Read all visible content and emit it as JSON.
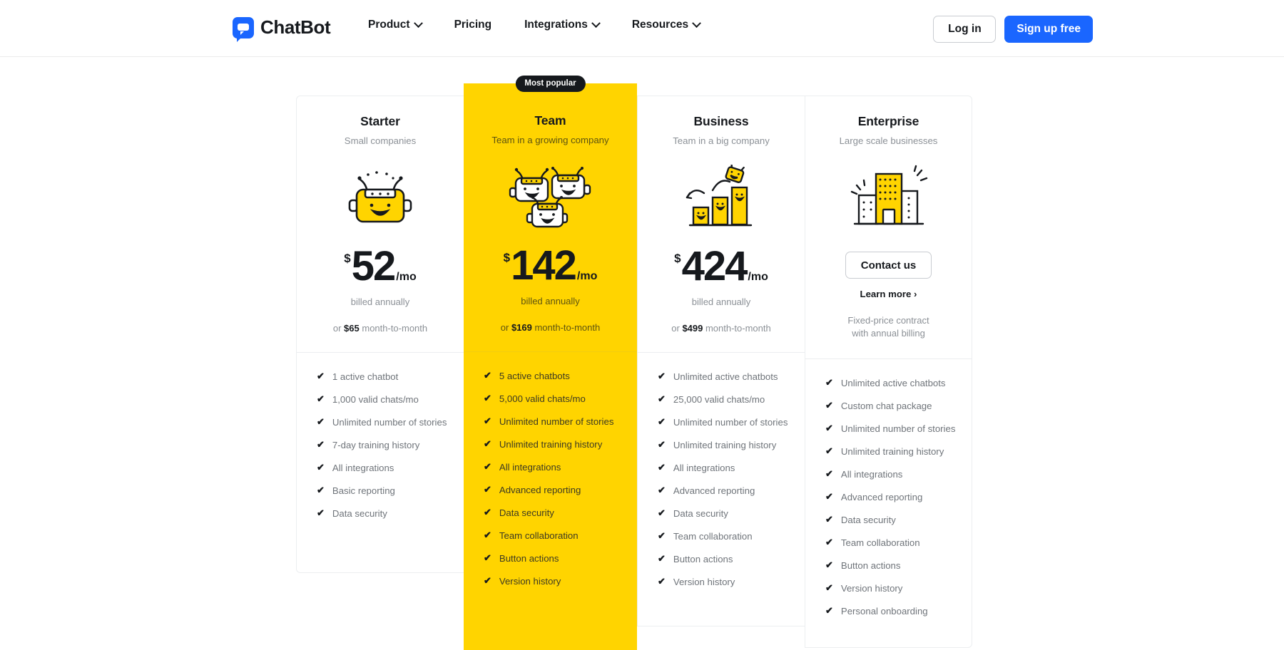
{
  "header": {
    "logo_text": "ChatBot",
    "nav": [
      {
        "label": "Product",
        "has_caret": true
      },
      {
        "label": "Pricing",
        "has_caret": false
      },
      {
        "label": "Integrations",
        "has_caret": true
      },
      {
        "label": "Resources",
        "has_caret": true
      }
    ],
    "login_label": "Log in",
    "signup_label": "Sign up free"
  },
  "colors": {
    "brand_blue": "#1a66ff",
    "accent_yellow": "#ffd400",
    "ink": "#16191d",
    "muted": "#8b9096"
  },
  "plans": [
    {
      "name": "Starter",
      "subtitle": "Small companies",
      "icon": "robot-single-icon",
      "currency": "$",
      "amount": "52",
      "period": "/mo",
      "billed": "billed annually",
      "monthly_prefix": "or ",
      "monthly_price": "$65",
      "monthly_suffix": " month-to-month",
      "features": [
        "1 active chatbot",
        "1,000 valid chats/mo",
        "Unlimited number of stories",
        "7-day training history",
        "All integrations",
        "Basic reporting",
        "Data security"
      ]
    },
    {
      "name": "Team",
      "subtitle": "Team in a growing company",
      "badge": "Most popular",
      "icon": "robot-group-icon",
      "currency": "$",
      "amount": "142",
      "period": "/mo",
      "billed": "billed annually",
      "monthly_prefix": "or ",
      "monthly_price": "$169",
      "monthly_suffix": " month-to-month",
      "features": [
        "5 active chatbots",
        "5,000 valid chats/mo",
        "Unlimited number of stories",
        "Unlimited training history",
        "All integrations",
        "Advanced reporting",
        "Data security",
        "Team collaboration",
        "Button actions",
        "Version history"
      ]
    },
    {
      "name": "Business",
      "subtitle": "Team in a big company",
      "icon": "growth-bars-icon",
      "currency": "$",
      "amount": "424",
      "period": "/mo",
      "billed": "billed annually",
      "monthly_prefix": "or ",
      "monthly_price": "$499",
      "monthly_suffix": " month-to-month",
      "features": [
        "Unlimited active chatbots",
        "25,000 valid chats/mo",
        "Unlimited number of stories",
        "Unlimited training history",
        "All integrations",
        "Advanced reporting",
        "Data security",
        "Team collaboration",
        "Button actions",
        "Version history"
      ]
    },
    {
      "name": "Enterprise",
      "subtitle": "Large scale businesses",
      "icon": "buildings-icon",
      "contact_label": "Contact us",
      "learn_more_label": "Learn more ›",
      "note_line1": "Fixed-price contract",
      "note_line2": "with annual billing",
      "features": [
        "Unlimited active chatbots",
        "Custom chat package",
        "Unlimited number of stories",
        "Unlimited training history",
        "All integrations",
        "Advanced reporting",
        "Data security",
        "Team collaboration",
        "Button actions",
        "Version history",
        "Personal onboarding"
      ]
    }
  ]
}
